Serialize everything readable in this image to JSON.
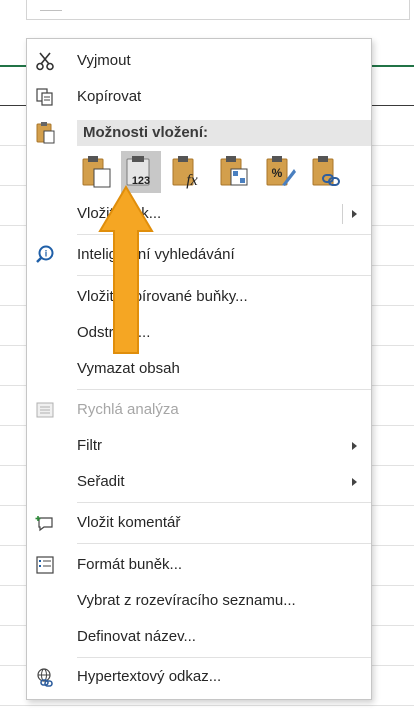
{
  "menu": {
    "cut": "Vyjmout",
    "copy": "Kopírovat",
    "paste_options": "Možnosti vložení:",
    "paste_buttons": [
      {
        "icon": "paste-icon"
      },
      {
        "icon": "paste-values-icon",
        "badge": "123"
      },
      {
        "icon": "paste-formulas-icon",
        "badge": "fx"
      },
      {
        "icon": "paste-transpose-icon"
      },
      {
        "icon": "paste-formatting-icon",
        "badge": "%"
      },
      {
        "icon": "paste-link-icon"
      }
    ],
    "paste_special": "Vložit jinak...",
    "smart_lookup": "Inteligentní vyhledávání",
    "insert_copied": "Vložit kopírované buňky...",
    "delete": "Odstranit...",
    "clear": "Vymazat obsah",
    "quick_analysis": "Rychlá analýza",
    "filter": "Filtr",
    "sort": "Seřadit",
    "insert_comment": "Vložit komentář",
    "format_cells": "Formát buněk...",
    "pick_list": "Vybrat z rozevíracího seznamu...",
    "define_name": "Definovat název...",
    "hyperlink": "Hypertextový odkaz..."
  },
  "colors": {
    "accent_green": "#217346",
    "arrow_fill": "#f5a623",
    "paste_icon": "#d39f4c"
  }
}
